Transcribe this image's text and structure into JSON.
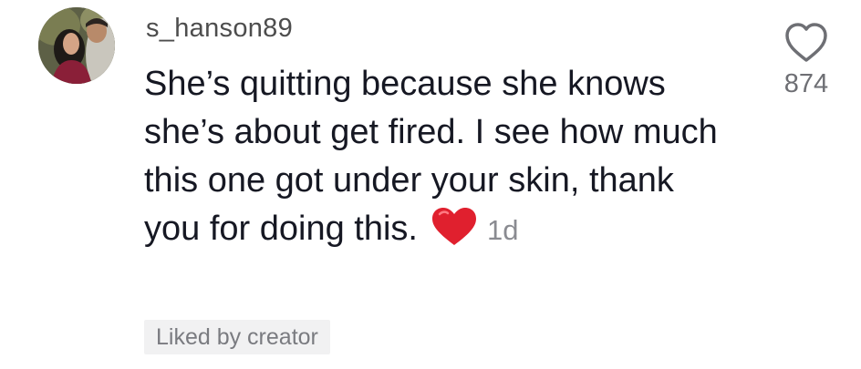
{
  "comment": {
    "username": "s_hanson89",
    "text": "She’s quitting because she knows she’s about get fired. I see how much this one got under your skin, thank you for doing this.",
    "emoji": "red-heart",
    "timestamp": "1d",
    "liked_by_creator_label": "Liked by creator"
  },
  "like": {
    "icon": "heart-outline-icon",
    "count": "874"
  },
  "colors": {
    "text_primary": "#161823",
    "text_secondary": "#8a8b91",
    "badge_bg": "#f1f1f2",
    "heart_red": "#e0202e"
  }
}
